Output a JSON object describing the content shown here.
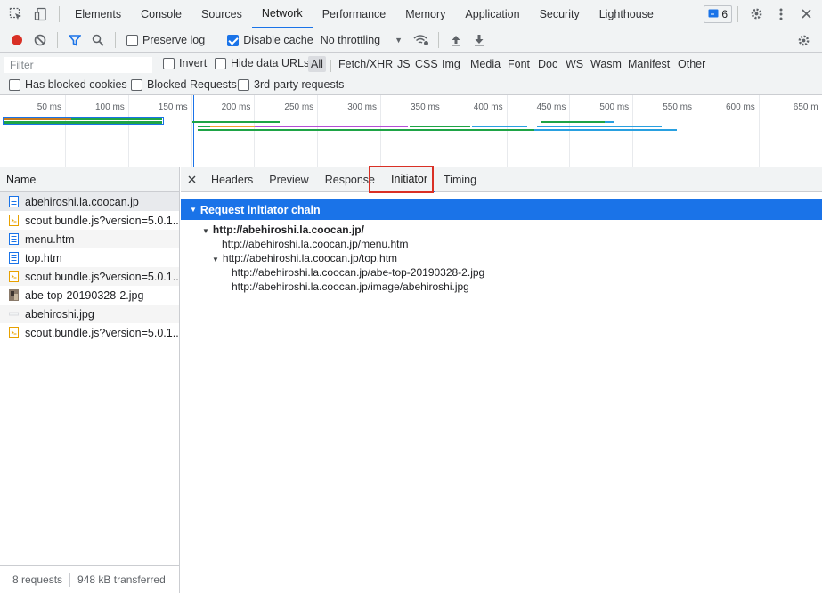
{
  "topbar": {
    "tabs": [
      "Elements",
      "Console",
      "Sources",
      "Network",
      "Performance",
      "Memory",
      "Application",
      "Security",
      "Lighthouse"
    ],
    "active_tab": "Network",
    "issues_count": "6"
  },
  "toolbar": {
    "preserve_log": "Preserve log",
    "disable_cache": "Disable cache",
    "throttling": "No throttling"
  },
  "filter": {
    "placeholder": "Filter",
    "invert": "Invert",
    "hide_data_urls": "Hide data URLs",
    "types": [
      "All",
      "Fetch/XHR",
      "JS",
      "CSS",
      "Img",
      "Media",
      "Font",
      "Doc",
      "WS",
      "Wasm",
      "Manifest",
      "Other"
    ],
    "has_blocked_cookies": "Has blocked cookies",
    "blocked_requests": "Blocked Requests",
    "third_party": "3rd-party requests"
  },
  "timeline": {
    "ticks": [
      "50 ms",
      "100 ms",
      "150 ms",
      "200 ms",
      "250 ms",
      "300 ms",
      "350 ms",
      "400 ms",
      "450 ms",
      "500 ms",
      "550 ms",
      "600 ms",
      "650 m"
    ]
  },
  "names": {
    "header": "Name",
    "requests": [
      {
        "name": "abehiroshi.la.coocan.jp",
        "type": "doc"
      },
      {
        "name": "scout.bundle.js?version=5.0.1...",
        "type": "js"
      },
      {
        "name": "menu.htm",
        "type": "doc"
      },
      {
        "name": "top.htm",
        "type": "doc"
      },
      {
        "name": "scout.bundle.js?version=5.0.1...",
        "type": "js"
      },
      {
        "name": "abe-top-20190328-2.jpg",
        "type": "img"
      },
      {
        "name": "abehiroshi.jpg",
        "type": "blank"
      },
      {
        "name": "scout.bundle.js?version=5.0.1...",
        "type": "js"
      }
    ]
  },
  "detail": {
    "tabs": [
      "Headers",
      "Preview",
      "Response",
      "Initiator",
      "Timing"
    ],
    "active_tab": "Initiator",
    "chain_header": "Request initiator chain",
    "chain": [
      {
        "text": "http://abehiroshi.la.coocan.jp/",
        "level": 0,
        "toggle": true,
        "bold": true
      },
      {
        "text": "http://abehiroshi.la.coocan.jp/menu.htm",
        "level": 1,
        "toggle": false,
        "bold": false
      },
      {
        "text": "http://abehiroshi.la.coocan.jp/top.htm",
        "level": 1,
        "toggle": true,
        "bold": false
      },
      {
        "text": "http://abehiroshi.la.coocan.jp/abe-top-20190328-2.jpg",
        "level": 2,
        "toggle": false,
        "bold": false
      },
      {
        "text": "http://abehiroshi.la.coocan.jp/image/abehiroshi.jpg",
        "level": 2,
        "toggle": false,
        "bold": false
      }
    ]
  },
  "status": {
    "requests": "8 requests",
    "transferred": "948 kB transferred"
  },
  "colors": {
    "accent": "#1a73e8",
    "record": "#d93025",
    "highlight": "#d93025"
  }
}
